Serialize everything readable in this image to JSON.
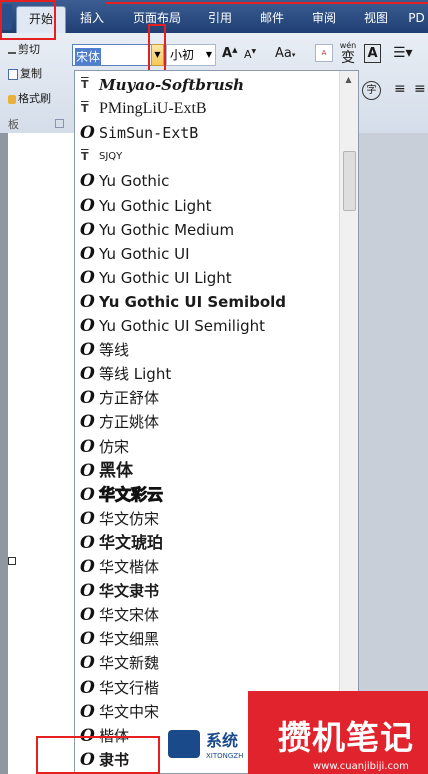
{
  "ribbon_tabs": [
    "开始",
    "插入",
    "页面布局",
    "引用",
    "邮件",
    "审阅",
    "视图",
    "PD"
  ],
  "clipboard": {
    "cut": "剪切",
    "copy": "复制",
    "format_painter": "格式刷",
    "group_label": "板"
  },
  "font_box": {
    "value": "宋体"
  },
  "size_box": {
    "value": "小初"
  },
  "ribbon_buttons": {
    "grow": "A",
    "shrink": "A",
    "case": "Aa",
    "pinyin": "wén",
    "pinyin_char": "变",
    "border_char": "A",
    "circle_char": "字"
  },
  "font_list": [
    {
      "name": "Muyao-Softbrush",
      "icon": "T"
    },
    {
      "name": "PMingLiU-ExtB",
      "icon": "T"
    },
    {
      "name": "SimSun-ExtB",
      "icon": "O"
    },
    {
      "name": "SJQY",
      "icon": "T"
    },
    {
      "name": "Yu Gothic",
      "icon": "O"
    },
    {
      "name": "Yu Gothic Light",
      "icon": "O"
    },
    {
      "name": "Yu Gothic Medium",
      "icon": "O"
    },
    {
      "name": "Yu Gothic UI",
      "icon": "O"
    },
    {
      "name": "Yu Gothic UI Light",
      "icon": "O"
    },
    {
      "name": "Yu Gothic UI Semibold",
      "icon": "O"
    },
    {
      "name": "Yu Gothic UI Semilight",
      "icon": "O"
    },
    {
      "name": "等线",
      "icon": "O"
    },
    {
      "name": "等线 Light",
      "icon": "O"
    },
    {
      "name": "方正舒体",
      "icon": "O"
    },
    {
      "name": "方正姚体",
      "icon": "O"
    },
    {
      "name": "仿宋",
      "icon": "O"
    },
    {
      "name": "黑体",
      "icon": "O"
    },
    {
      "name": "华文彩云",
      "icon": "O"
    },
    {
      "name": "华文仿宋",
      "icon": "O"
    },
    {
      "name": "华文琥珀",
      "icon": "O"
    },
    {
      "name": "华文楷体",
      "icon": "O"
    },
    {
      "name": "华文隶书",
      "icon": "O"
    },
    {
      "name": "华文宋体",
      "icon": "O"
    },
    {
      "name": "华文细黑",
      "icon": "O"
    },
    {
      "name": "华文新魏",
      "icon": "O"
    },
    {
      "name": "华文行楷",
      "icon": "O"
    },
    {
      "name": "华文中宋",
      "icon": "O"
    },
    {
      "name": "楷体",
      "icon": "O"
    },
    {
      "name": "隶书",
      "icon": "O"
    }
  ],
  "watermark": {
    "brand": "攒机笔记",
    "url": "www.cuanjibiji.com",
    "logo_text": "系统",
    "logo_sub": "XITONGZH"
  }
}
